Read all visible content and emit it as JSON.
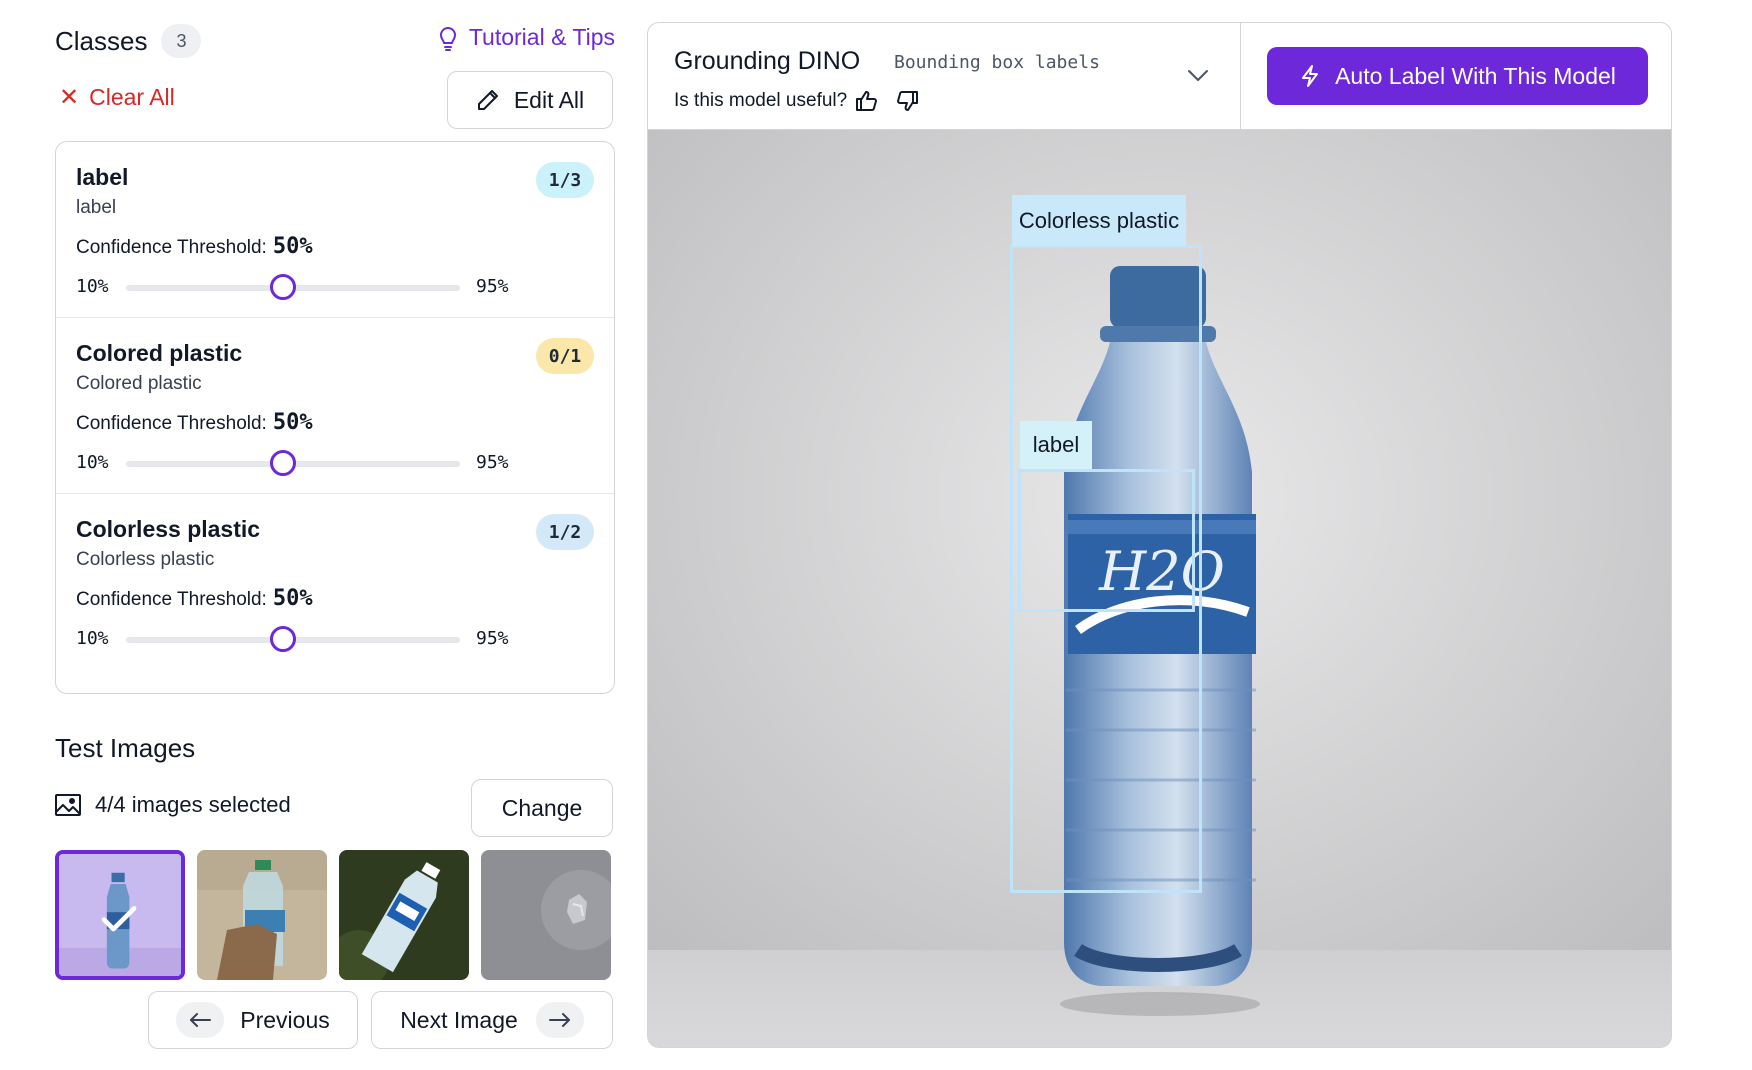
{
  "classes_panel": {
    "title": "Classes",
    "count": "3",
    "tutorial_label": "Tutorial & Tips",
    "clear_all_label": "Clear All",
    "edit_all_label": "Edit All",
    "items": [
      {
        "name": "label",
        "subtitle": "label",
        "badge": "1/3",
        "badge_color": "#cbf2fb",
        "confidence_label": "Confidence Threshold:",
        "confidence_value": "50%",
        "slider_min": "10%",
        "slider_max": "95%",
        "slider_percent": 47
      },
      {
        "name": "Colored plastic",
        "subtitle": "Colored plastic",
        "badge": "0/1",
        "badge_color": "#fbe7a9",
        "confidence_label": "Confidence Threshold:",
        "confidence_value": "50%",
        "slider_min": "10%",
        "slider_max": "95%",
        "slider_percent": 47
      },
      {
        "name": "Colorless plastic",
        "subtitle": "Colorless plastic",
        "badge": "1/2",
        "badge_color": "#d3e9f9",
        "confidence_label": "Confidence Threshold:",
        "confidence_value": "50%",
        "slider_min": "10%",
        "slider_max": "95%",
        "slider_percent": 47
      }
    ]
  },
  "test_images": {
    "title": "Test Images",
    "selected_count": "4/4",
    "selected_suffix": "images selected",
    "change_label": "Change",
    "previous_label": "Previous",
    "next_label": "Next Image",
    "thumbnails": [
      {
        "alt_icon": "bottle-on-purple-thumbnail",
        "selected": true
      },
      {
        "alt_icon": "bottle-in-hand-thumbnail",
        "selected": false
      },
      {
        "alt_icon": "aqua-bottle-on-grass-thumbnail",
        "selected": false
      },
      {
        "alt_icon": "crushed-bottle-thumbnail",
        "selected": false
      }
    ]
  },
  "model": {
    "name": "Grounding DINO",
    "type": "Bounding box labels",
    "useful_prompt": "Is this model useful?",
    "auto_label_button": "Auto Label With This Model"
  },
  "detections": [
    {
      "label": "Colorless plastic"
    },
    {
      "label": "label"
    }
  ],
  "colors": {
    "accent": "#6d28d9",
    "danger": "#dc2626",
    "bbox_border": "#bfe3f8",
    "bbox_tag": "#c9e8f9"
  }
}
